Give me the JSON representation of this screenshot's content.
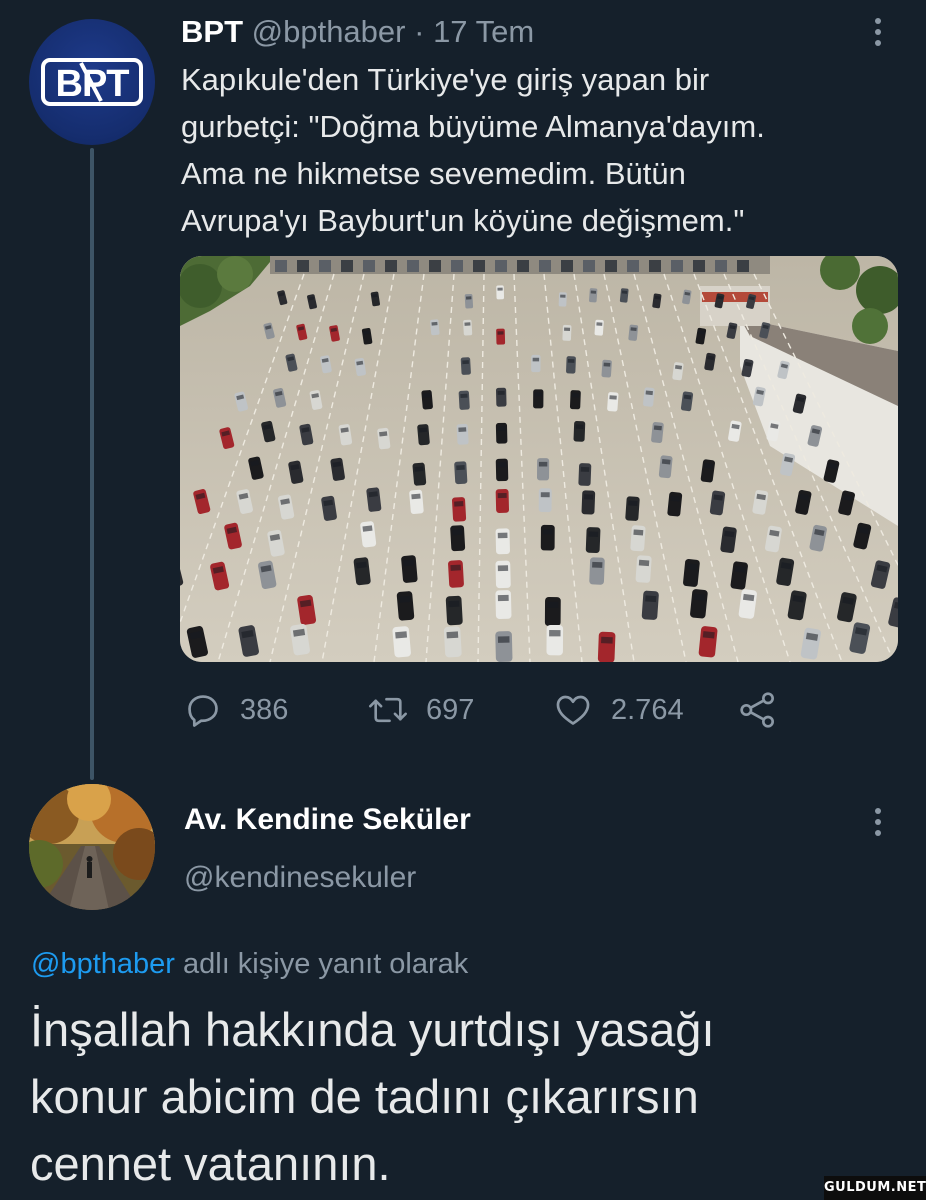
{
  "tweet": {
    "author_name": "BPT",
    "author_handle": "@bpthaber",
    "separator": "·",
    "date": "17 Tem",
    "avatar_text": "BPT",
    "text": "Kapıkule'den Türkiye'ye giriş yapan bir\ngurbetçi: \"Doğma büyüme Almanya'dayım.\nAma ne hikmetse sevemedim. Bütün\nAvrupa'yı Bayburt'un köyüne değişmem.\"",
    "actions": {
      "replies": "386",
      "retweets": "697",
      "likes": "2.764"
    }
  },
  "reply": {
    "author_name": "Av. Kendine Seküler",
    "author_handle": "@kendinesekuler",
    "reply_to_handle": "@bpthaber",
    "reply_context_suffix": " adlı kişiye yanıt olarak",
    "text": "İnşallah hakkında yurtdışı yasağı\nkonur abicim de tadını çıkarırsın\ncennet vatanının."
  },
  "icons": {
    "more": "more-vertical-icon",
    "reply": "reply-icon",
    "retweet": "retweet-icon",
    "like": "heart-icon",
    "share": "share-icon"
  },
  "colors": {
    "background": "#15202b",
    "secondary_text": "#8b98a5",
    "link": "#1d9bf0",
    "avatar_bpt": "#1e3a8a"
  },
  "watermark": "GULDUM.NET"
}
